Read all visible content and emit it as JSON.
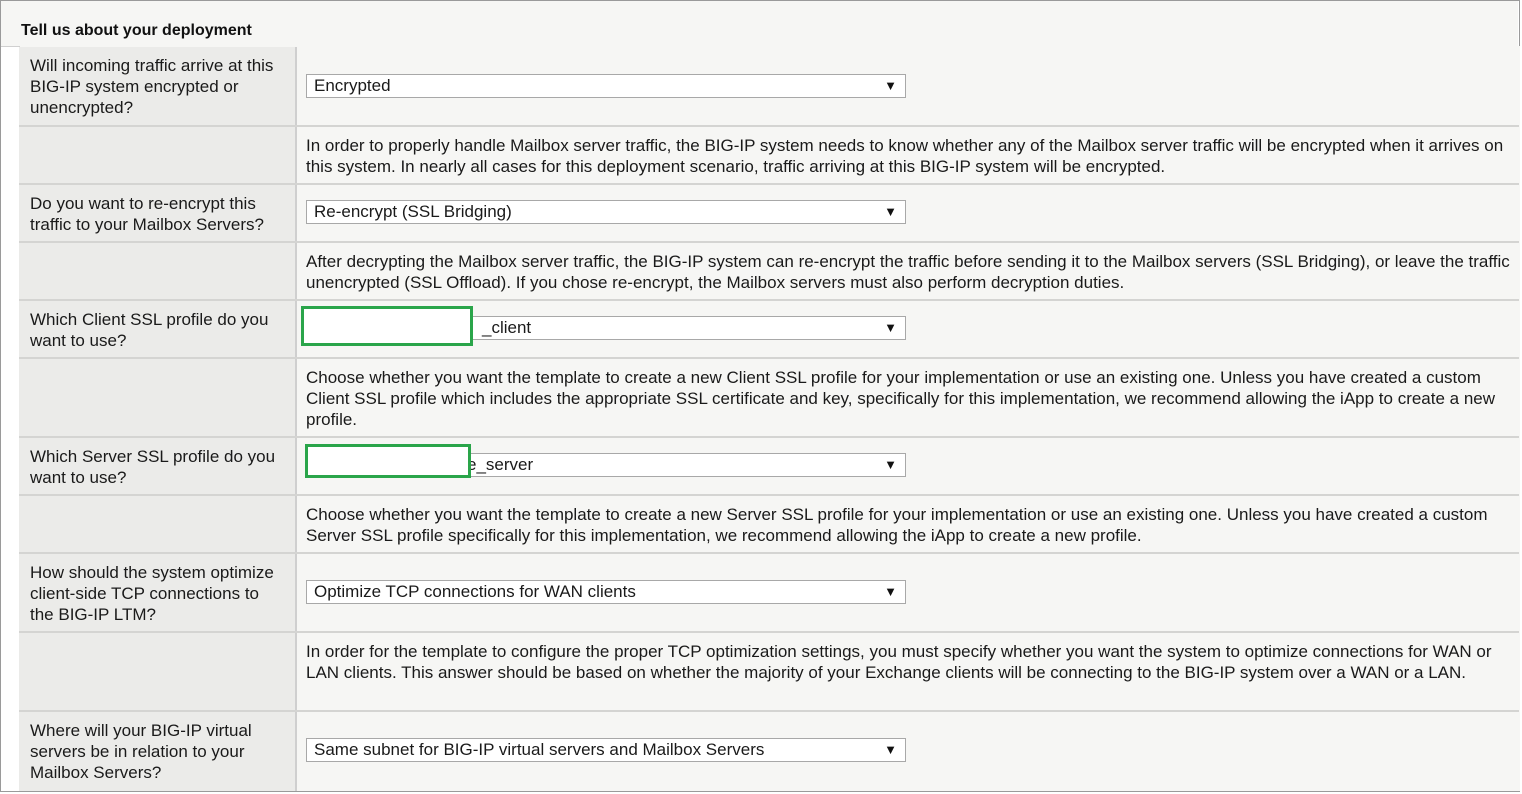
{
  "section": {
    "title": "Tell us about your deployment"
  },
  "rows": [
    {
      "question": "Will incoming traffic arrive at this BIG-IP system encrypted or unencrypted?",
      "value": "Encrypted",
      "help": "In order to properly handle Mailbox server traffic, the BIG-IP system needs to know whether any of the Mailbox server traffic will be encrypted when it arrives on this system. In nearly all cases for this deployment scenario, traffic arriving at this BIG-IP system will be encrypted."
    },
    {
      "question": "Do you want to re-encrypt this traffic to your Mailbox Servers?",
      "value": "Re-encrypt (SSL Bridging)",
      "help": "After decrypting the Mailbox server traffic, the BIG-IP system can re-encrypt the traffic before sending it to the Mailbox servers (SSL Bridging), or leave the traffic unencrypted (SSL Offload). If you chose re-encrypt, the Mailbox servers must also perform decryption duties."
    },
    {
      "question": "Which Client SSL profile do you want to use?",
      "value": "_client",
      "help": "Choose whether you want the template to create a new Client SSL profile for your implementation or use an existing one. Unless you have created a custom Client SSL profile which includes the appropriate SSL certificate and key, specifically for this implementation, we recommend allowing the iApp to create a new profile."
    },
    {
      "question": "Which Server SSL profile do you want to use?",
      "value": "e_server",
      "help": "Choose whether you want the template to create a new Server SSL profile for your implementation or use an existing one. Unless you have created a custom Server SSL profile specifically for this implementation, we recommend allowing the iApp to create a new profile."
    },
    {
      "question": "How should the system optimize client-side TCP connections to the BIG-IP LTM?",
      "value": "Optimize TCP connections for WAN clients",
      "help": "In order for the template to configure the proper TCP optimization settings, you must specify whether you want the system to optimize connections for WAN or LAN clients. This answer should be based on whether the majority of your Exchange clients will be connecting to the BIG-IP system over a WAN or a LAN."
    },
    {
      "question": "Where will your BIG-IP virtual servers be in relation to your Mailbox Servers?",
      "value": "Same subnet for BIG-IP virtual servers and Mailbox Servers"
    }
  ],
  "icons": {
    "dropdown": "dropdown-arrow-icon",
    "arrow_glyph": "▼"
  },
  "colors": {
    "highlight": "#2aa54a",
    "label_bg": "#ebebe9",
    "content_bg": "#f6f6f4"
  }
}
